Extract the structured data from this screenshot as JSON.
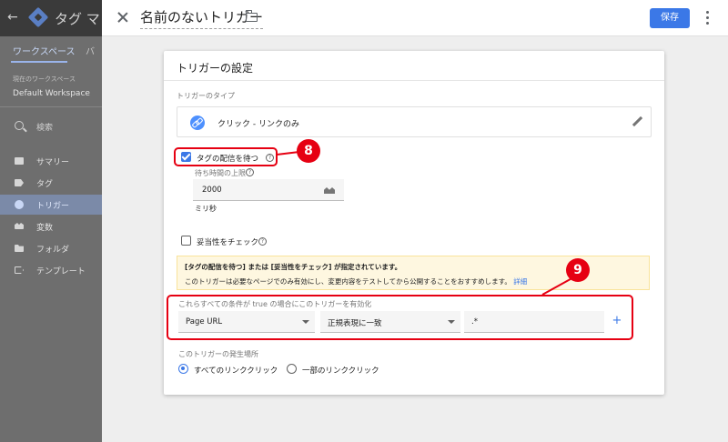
{
  "app": {
    "back_glyph": "←",
    "title": "タグ マネージャー"
  },
  "background_tabs": {
    "workspace": "ワークスペース",
    "version_fragment": "バ"
  },
  "workspace": {
    "label": "現在のワークスペース",
    "name": "Default Workspace"
  },
  "search": {
    "label": "検索"
  },
  "sidebar": {
    "items": [
      {
        "label": "サマリー",
        "icon": "summary-icon"
      },
      {
        "label": "タグ",
        "icon": "tag-icon"
      },
      {
        "label": "トリガー",
        "icon": "trigger-icon",
        "active": true
      },
      {
        "label": "変数",
        "icon": "variables-icon"
      },
      {
        "label": "フォルダ",
        "icon": "folder-icon"
      },
      {
        "label": "テンプレート",
        "icon": "template-icon"
      }
    ]
  },
  "editor": {
    "trigger_name": "名前のないトリガー",
    "save_label": "保存"
  },
  "card": {
    "title": "トリガーの設定",
    "type_label": "トリガーのタイプ",
    "type_value": "クリック - リンクのみ",
    "wait_for_tags": {
      "label": "タグの配信を待つ",
      "checked": true,
      "max_wait_label": "待ち時間の上限",
      "max_wait_value": "2000",
      "unit": "ミリ秒"
    },
    "check_validation": {
      "label": "妥当性をチェック",
      "checked": false
    },
    "info": {
      "title": "[タグの配信を待つ] または [妥当性をチェック] が指定されています。",
      "body": "このトリガーは必要なページでのみ有効にし、変更内容をテストしてから公開することをおすすめします。",
      "link": "詳細"
    },
    "conditions": {
      "label": "これらすべての条件が true の場合にこのトリガーを有効化",
      "variable": "Page URL",
      "operator": "正規表現に一致",
      "value": ".*",
      "add_glyph": "+"
    },
    "fires_on": {
      "label": "このトリガーの発生場所",
      "options": [
        {
          "label": "すべてのリンククリック",
          "selected": true
        },
        {
          "label": "一部のリンククリック",
          "selected": false
        }
      ]
    }
  },
  "annotations": {
    "marker_8": "8",
    "marker_9": "9",
    "color": "#e60012"
  },
  "colors": {
    "accent": "#3b78e7",
    "info_bg": "#fef7e0"
  }
}
